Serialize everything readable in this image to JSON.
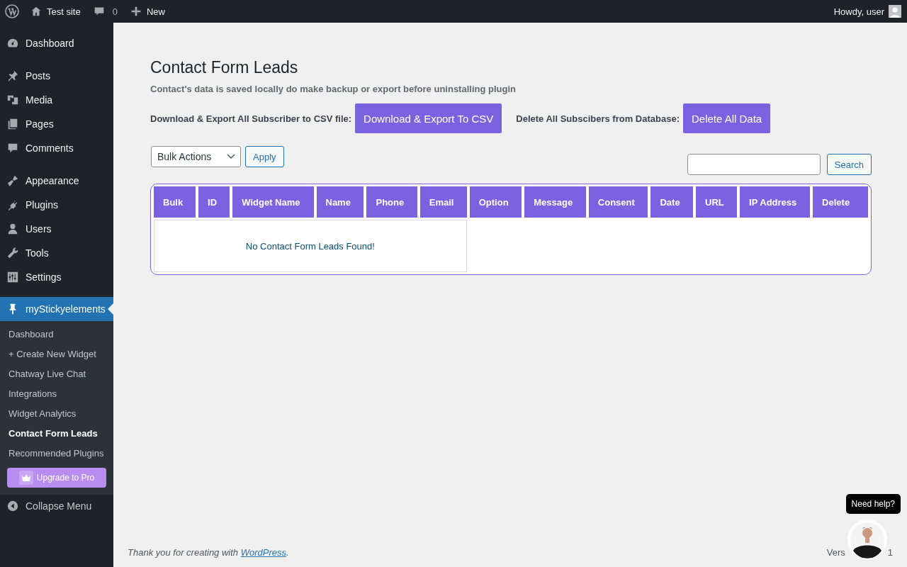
{
  "admin_bar": {
    "site": "Test site",
    "comments": "0",
    "new": "New",
    "greeting": "Howdy, user"
  },
  "sidebar": {
    "groups": [
      [
        {
          "label": "Dashboard",
          "kind": "gauge"
        }
      ],
      [
        {
          "label": "Posts",
          "kind": "pin"
        },
        {
          "label": "Media",
          "kind": "media"
        },
        {
          "label": "Pages",
          "kind": "pages"
        },
        {
          "label": "Comments",
          "kind": "bubble"
        }
      ],
      [
        {
          "label": "Appearance",
          "kind": "brush"
        },
        {
          "label": "Plugins",
          "kind": "plug"
        },
        {
          "label": "Users",
          "kind": "user"
        },
        {
          "label": "Tools",
          "kind": "wrench"
        },
        {
          "label": "Settings",
          "kind": "sliders"
        }
      ]
    ],
    "current": {
      "label": "myStickyelements",
      "kind": "pushpin"
    },
    "submenu": [
      {
        "label": "Dashboard",
        "selected": false
      },
      {
        "label": "+ Create New Widget",
        "selected": false
      },
      {
        "label": "Chatway Live Chat",
        "selected": false
      },
      {
        "label": "Integrations",
        "selected": false
      },
      {
        "label": "Widget Analytics",
        "selected": false
      },
      {
        "label": "Contact Form Leads",
        "selected": true
      },
      {
        "label": "Recommended Plugins",
        "selected": false
      }
    ],
    "upgrade": "Upgrade to Pro",
    "collapse": "Collapse Menu"
  },
  "page": {
    "title": "Contact Form Leads",
    "notice": "Contact's data is saved locally do make backup or export before uninstalling plugin",
    "export_label": "Download & Export All Subscriber to CSV file:",
    "export_button": "Download & Export To CSV",
    "delete_label": "Delete All Subscibers from Database:",
    "delete_button": "Delete All Data",
    "bulk_select": "Bulk Actions",
    "apply": "Apply",
    "search_button": "Search"
  },
  "table": {
    "columns": [
      "Bulk",
      "ID",
      "Widget Name",
      "Name",
      "Phone",
      "Email",
      "Option",
      "Message",
      "Consent",
      "Date",
      "URL",
      "IP Address",
      "Delete"
    ],
    "empty": "No Contact Form Leads Found!"
  },
  "footer": {
    "thanks": "Thank you for creating with ",
    "link": "WordPress",
    "after": ".",
    "version_start": "Vers",
    "version_end": "1"
  },
  "help": {
    "tooltip": "Need help?"
  }
}
